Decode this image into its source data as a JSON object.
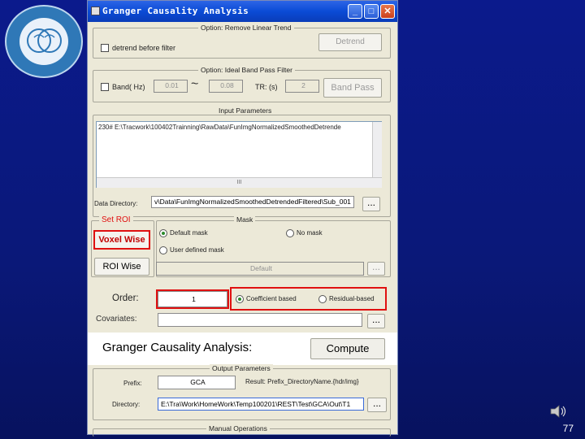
{
  "window": {
    "title": "Granger Causality Analysis",
    "minimize": "_",
    "maximize": "□",
    "close": "✕"
  },
  "detrend": {
    "panel_title": "Option: Remove Linear Trend",
    "checkbox_label": "detrend before filter",
    "button": "Detrend"
  },
  "bandpass": {
    "panel_title": "Option: Ideal Band Pass Filter",
    "checkbox_label": "Band( Hz)",
    "low": "0.01",
    "tilde": "~",
    "high": "0.08",
    "tr_label": "TR: (s)",
    "tr": "2",
    "button": "Band Pass"
  },
  "input": {
    "panel_title": "Input Parameters",
    "list_item": "230# E:\\Tracwork\\100402Trainning\\RawData\\FunImgNormalizedSmoothedDetrende",
    "scroll_mark": "III",
    "dir_label": "Data Directory:",
    "dir_value": "v\\Data\\FunImgNormalizedSmoothedDetrendedFiltered\\Sub_001",
    "browse": "..."
  },
  "roi": {
    "title": "Set ROI",
    "voxel_button": "Voxel Wise",
    "roi_button": "ROI Wise"
  },
  "mask": {
    "panel_title": "Mask",
    "default": "Default mask",
    "none": "No mask",
    "user": "User defined mask",
    "field": "Default",
    "browse": "..."
  },
  "order": {
    "label": "Order:",
    "value": "1",
    "coef": "Coefficient based",
    "resid": "Residual-based"
  },
  "covariates": {
    "label": "Covariates:",
    "browse": "..."
  },
  "compute": {
    "label": "Granger Causality Analysis:",
    "button": "Compute"
  },
  "output": {
    "panel_title": "Output Parameters",
    "prefix_label": "Prefix:",
    "prefix": "GCA",
    "result": "Result: Prefix_DirectoryName.{hdr/img}",
    "dir_label": "Directory:",
    "dir_value": "E:\\Tra\\Work\\HomeWork\\Temp100201\\REST\\Test\\GCA\\Out\\T1",
    "browse": "..."
  },
  "manual": {
    "panel_title": "Manual Operations"
  },
  "page_number": "77",
  "colors": {
    "background": "#0a1878",
    "title_bar": "#0a4bd6",
    "window": "#ece9d8",
    "highlight": "#e01010"
  }
}
